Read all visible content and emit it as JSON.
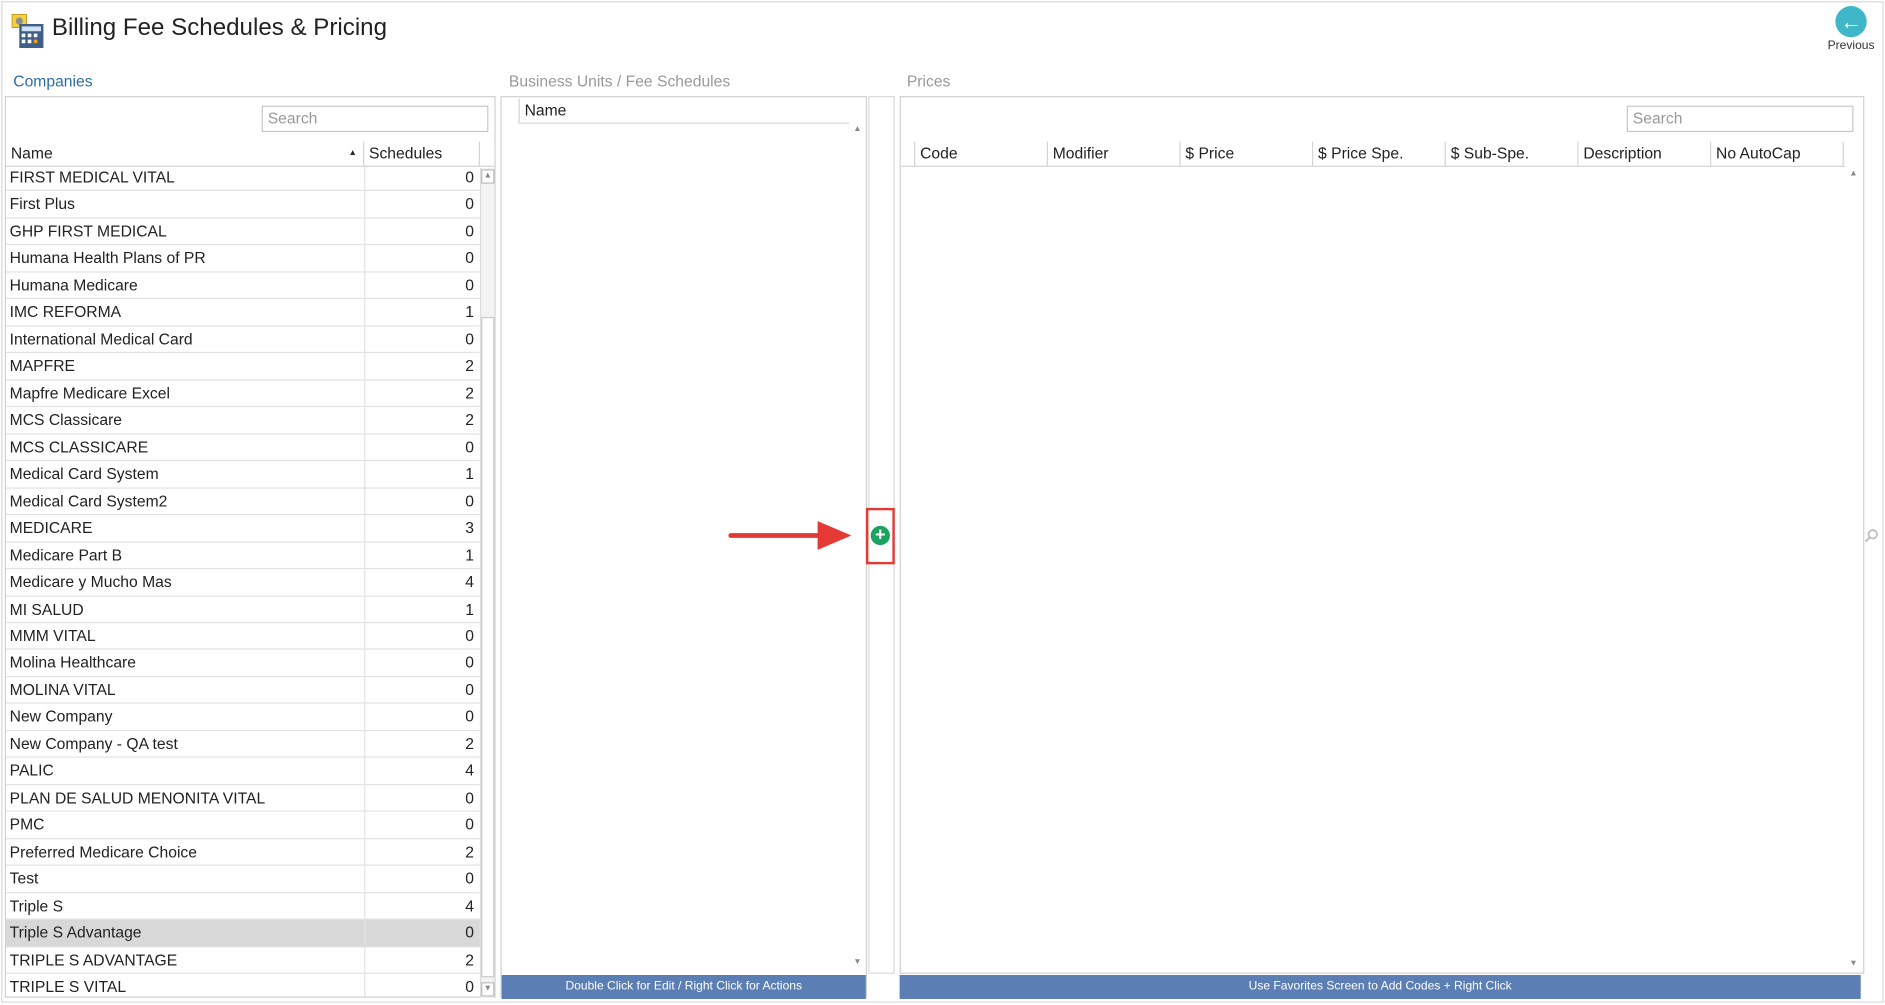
{
  "header": {
    "title": "Billing Fee Schedules & Pricing",
    "previous_label": "Previous"
  },
  "sections": {
    "companies": "Companies",
    "business_units": "Business Units / Fee Schedules",
    "prices": "Prices"
  },
  "companies": {
    "search_placeholder": "Search",
    "col_name": "Name",
    "col_schedules": "Schedules",
    "rows": [
      {
        "name": "FIRST MEDICAL VITAL",
        "schedules": "0"
      },
      {
        "name": "First Plus",
        "schedules": "0"
      },
      {
        "name": "GHP FIRST MEDICAL",
        "schedules": "0"
      },
      {
        "name": "Humana Health Plans of PR",
        "schedules": "0"
      },
      {
        "name": "Humana Medicare",
        "schedules": "0"
      },
      {
        "name": "IMC REFORMA",
        "schedules": "1"
      },
      {
        "name": "International Medical Card",
        "schedules": "0"
      },
      {
        "name": "MAPFRE",
        "schedules": "2"
      },
      {
        "name": "Mapfre Medicare Excel",
        "schedules": "2"
      },
      {
        "name": "MCS Classicare",
        "schedules": "2"
      },
      {
        "name": "MCS CLASSICARE",
        "schedules": "0"
      },
      {
        "name": "Medical Card System",
        "schedules": "1"
      },
      {
        "name": "Medical Card System2",
        "schedules": "0"
      },
      {
        "name": "MEDICARE",
        "schedules": "3"
      },
      {
        "name": "Medicare Part B",
        "schedules": "1"
      },
      {
        "name": "Medicare y Mucho Mas",
        "schedules": "4"
      },
      {
        "name": "MI SALUD",
        "schedules": "1"
      },
      {
        "name": "MMM VITAL",
        "schedules": "0"
      },
      {
        "name": "Molina Healthcare",
        "schedules": "0"
      },
      {
        "name": "MOLINA VITAL",
        "schedules": "0"
      },
      {
        "name": "New Company",
        "schedules": "0"
      },
      {
        "name": "New Company - QA test",
        "schedules": "2"
      },
      {
        "name": "PALIC",
        "schedules": "4"
      },
      {
        "name": "PLAN DE SALUD MENONITA VITAL",
        "schedules": "0"
      },
      {
        "name": "PMC",
        "schedules": "0"
      },
      {
        "name": "Preferred Medicare Choice",
        "schedules": "2"
      },
      {
        "name": "Test",
        "schedules": "0"
      },
      {
        "name": "Triple S",
        "schedules": "4"
      },
      {
        "name": "Triple S Advantage",
        "schedules": "0",
        "selected": true
      },
      {
        "name": "TRIPLE S ADVANTAGE",
        "schedules": "2"
      },
      {
        "name": "TRIPLE S VITAL",
        "schedules": "0"
      }
    ]
  },
  "fee_schedules": {
    "col_name": "Name",
    "footer": "Double Click for Edit / Right Click for Actions"
  },
  "prices": {
    "search_placeholder": "Search",
    "columns": [
      "Code",
      "Modifier",
      "$ Price",
      "$ Price Spe.",
      "$ Sub-Spe.",
      "Description",
      "No AutoCap"
    ],
    "footer": "Use Favorites Screen to Add Codes + Right Click"
  },
  "colors": {
    "footer_bg": "#5b7fb4",
    "accent": "#2e6da4",
    "annotation": "#e53935",
    "add": "#1aa260"
  }
}
